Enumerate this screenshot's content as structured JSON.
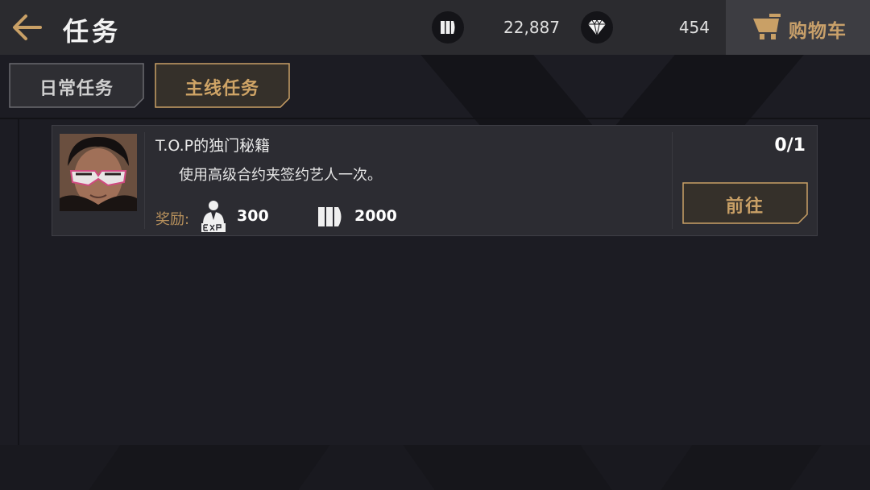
{
  "header": {
    "title": "任务",
    "tickets": "22,887",
    "diamonds": "454",
    "cart_label": "购物车"
  },
  "tabs": [
    {
      "label": "日常任务",
      "active": false
    },
    {
      "label": "主线任务",
      "active": true
    }
  ],
  "quests": [
    {
      "title": "T.O.P的独门秘籍",
      "description": "使用高级合约夹签约艺人一次。",
      "reward_label": "奖励:",
      "rewards": [
        {
          "icon": "exp-icon",
          "value": "300"
        },
        {
          "icon": "ticket-icon",
          "value": "2000"
        }
      ],
      "progress": "0/1",
      "go_label": "前往"
    }
  ],
  "colors": {
    "accent": "#c9a066",
    "header_bg": "#2b2b2f",
    "card_bg": "#2c2c32",
    "page_bg": "#1c1c23"
  }
}
